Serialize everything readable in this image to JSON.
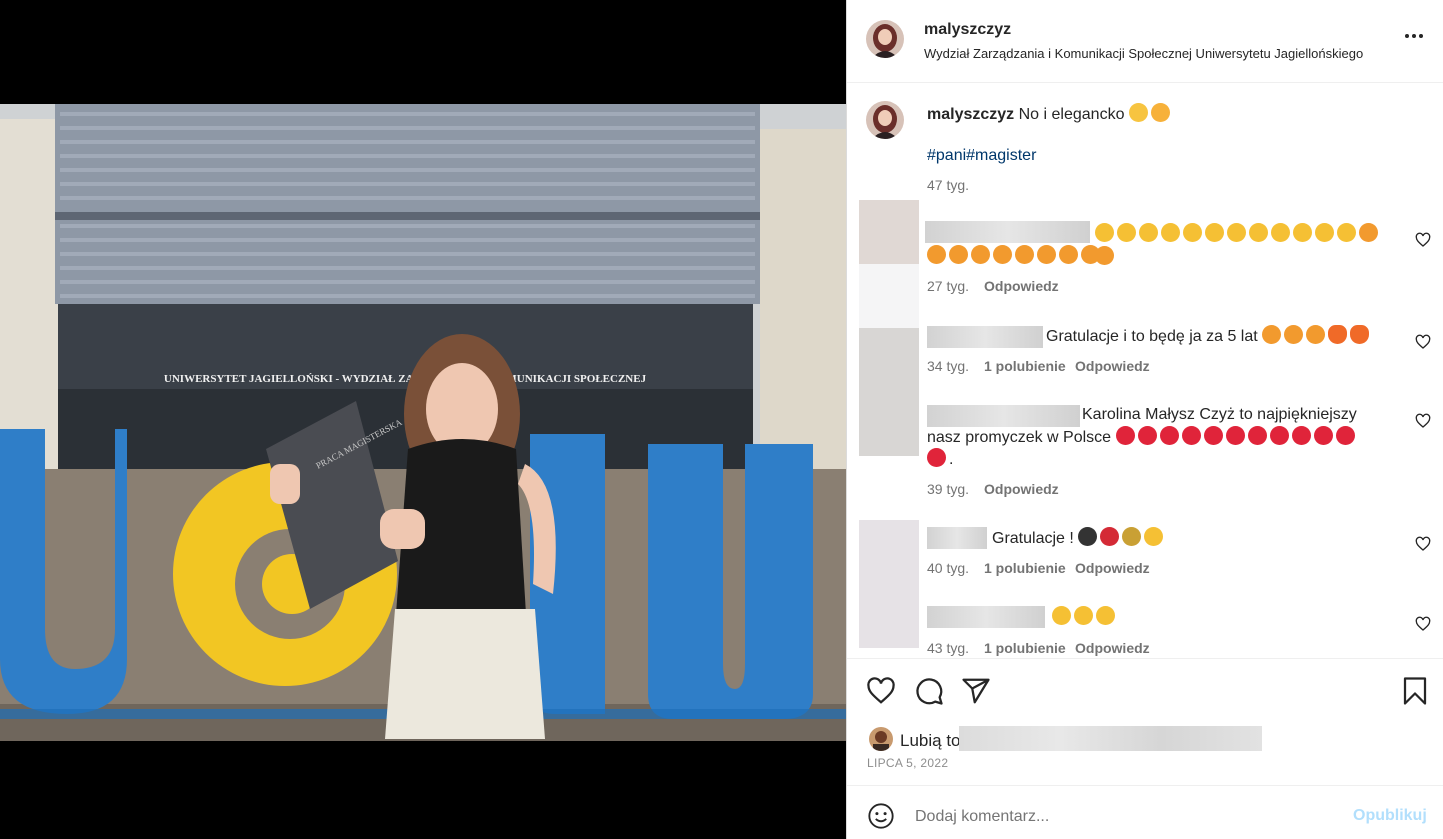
{
  "post": {
    "image_banner_text": "UNIWERSYTET JAGIELLOŃSKI - WYDZIAŁ ZARZĄDZANIA I KOMUNIKACJI SPOŁECZNEJ",
    "thesis_text": "PRACA MAGISTERSKA"
  },
  "header": {
    "username": "malyszczyz",
    "location": "Wydział Zarządzania i Komunikacji Społecznej Uniwersytetu Jagiellońskiego"
  },
  "caption": {
    "username": "malyszczyz",
    "text": "No i elegancko",
    "hashtags": "#pani#magister",
    "time": "47 tyg."
  },
  "comments": [
    {
      "text": "",
      "emojis": [
        "clap",
        "clap",
        "clap",
        "clap",
        "clap",
        "clap",
        "clap",
        "clap",
        "clap",
        "clap",
        "clap",
        "clap",
        "hearteyes",
        "hearteyes",
        "hearteyes",
        "hearteyes",
        "hearteyes",
        "hearteyes",
        "hearteyes",
        "hearteyes",
        "hearteyes",
        "hearteyes"
      ],
      "time": "27 tyg.",
      "likes": "",
      "reply": "Odpowiedz"
    },
    {
      "text": "Gratulacje i to będę ja za 5 lat",
      "emojis": [
        "hearteyes",
        "hearteyes",
        "hearteyes",
        "fire",
        "fire"
      ],
      "time": "34 tyg.",
      "likes": "1 polubienie",
      "reply": "Odpowiedz"
    },
    {
      "text_line1": "Karolina Małysz Czyż to najpiękniejszy",
      "text_line2": "nasz promyczek w Polsce",
      "end": ".",
      "time": "39 tyg.",
      "likes": "",
      "reply": "Odpowiedz"
    },
    {
      "text": "Gratulacje !",
      "time": "40 tyg.",
      "likes": "1 polubienie",
      "reply": "Odpowiedz"
    },
    {
      "text": "",
      "time": "43 tyg.",
      "likes": "1 polubienie",
      "reply": "Odpowiedz"
    }
  ],
  "likes": {
    "prefix": "Lubią to"
  },
  "date": "LIPCA 5, 2022",
  "add_comment": {
    "placeholder": "Dodaj komentarz...",
    "publish": "Opublikuj"
  },
  "colors": {
    "link": "#00376b",
    "publish_disabled": "#b2dffc",
    "muted": "#737373"
  }
}
